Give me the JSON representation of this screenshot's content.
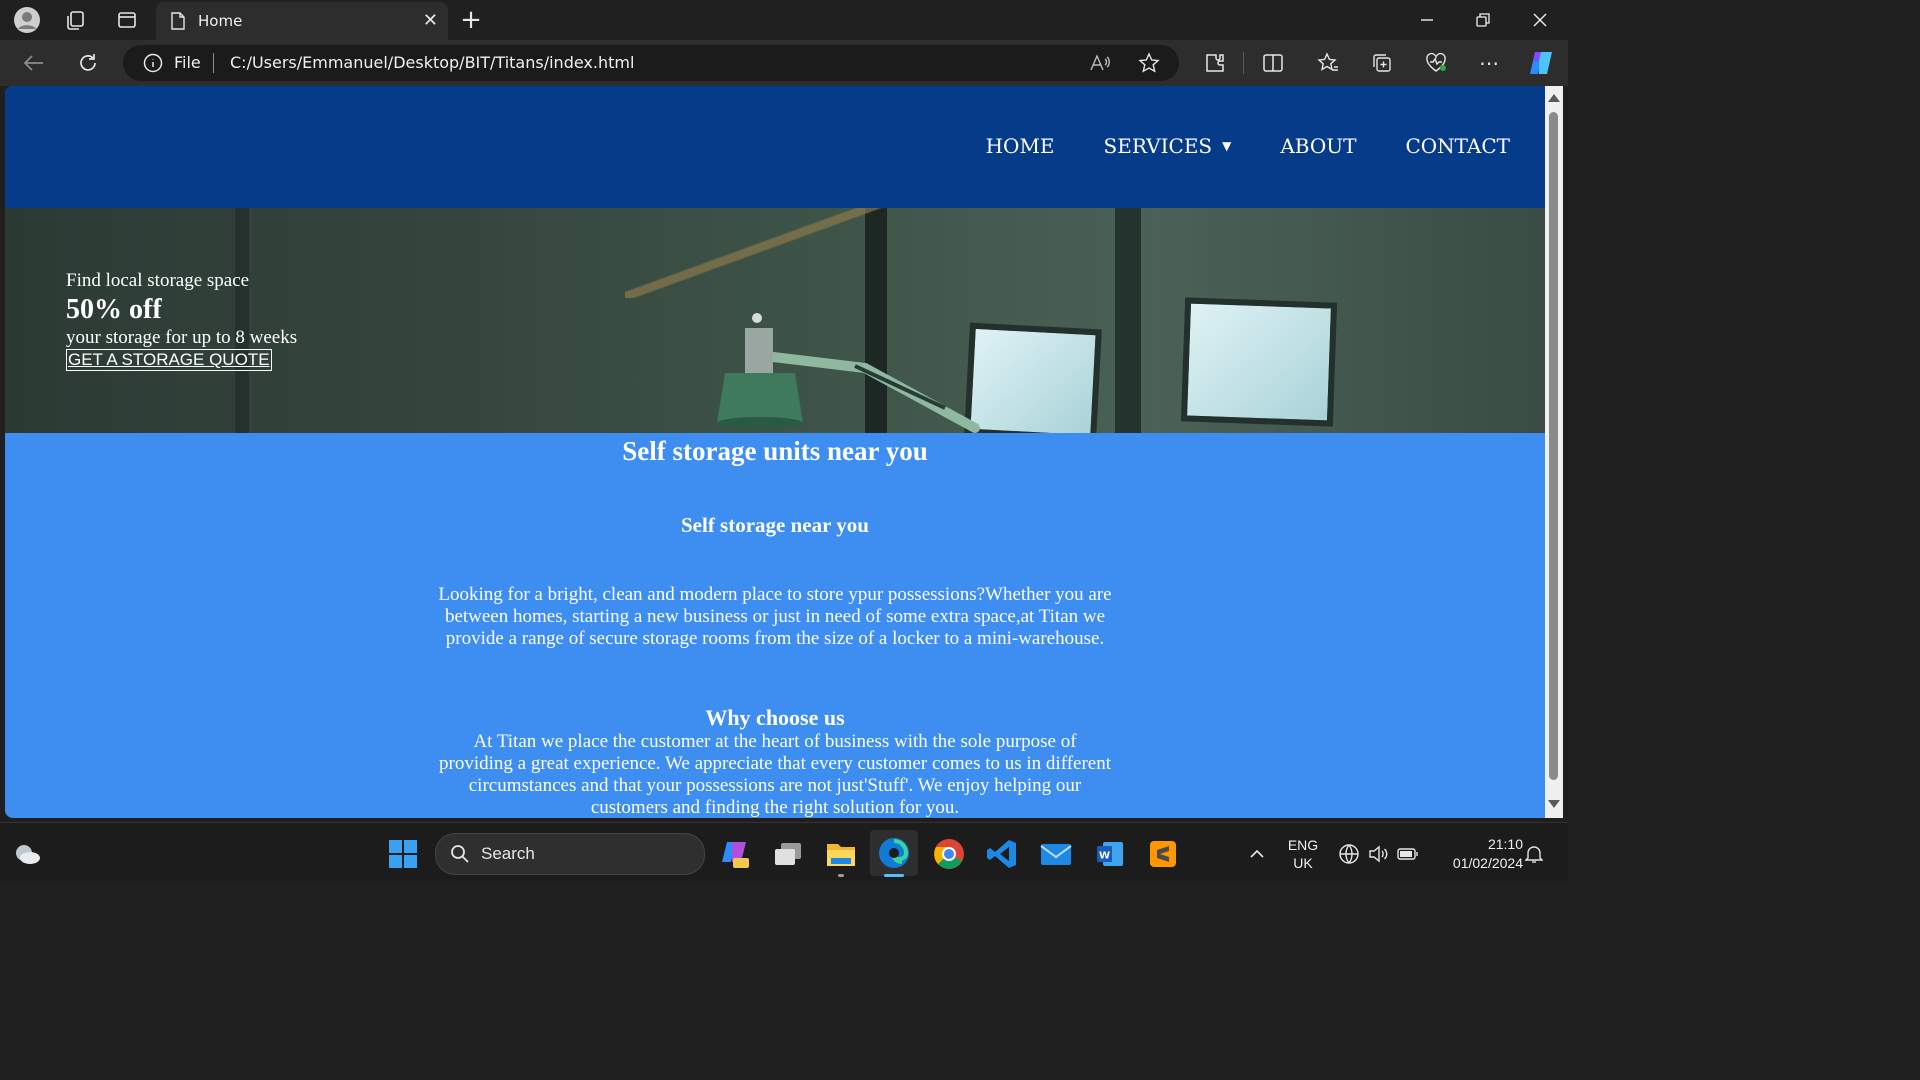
{
  "browser": {
    "tab_title": "Home",
    "address_scheme": "File",
    "address_url": "C:/Users/Emmanuel/Desktop/BIT/Titans/index.html"
  },
  "site": {
    "nav": [
      {
        "label": "HOME"
      },
      {
        "label": "SERVICES"
      },
      {
        "label": "ABOUT"
      },
      {
        "label": "CONTACT"
      }
    ],
    "hero": {
      "line1": "Find local storage space",
      "line2": "50% off",
      "line3": "your storage for up to 8 weeks",
      "cta": "GET A STORAGE QUOTE"
    },
    "main": {
      "title": "Self storage units near you",
      "subtitle": "Self storage near you",
      "intro": "Looking for a bright, clean and modern place to store ypur possessions?Whether you are between homes, starting a new business or just in need of some extra space,at Titan we provide a range of secure storage rooms from the size of a locker to a mini-warehouse.",
      "why_title": "Why choose us",
      "why_text": "At Titan we place the customer at the heart of business with the sole purpose of providing a great experience. We appreciate that every customer comes to us in different circumstances and that your possessions are not just'Stuff'. We enjoy helping our customers and finding the right solution for you."
    },
    "colors": {
      "header": "#053b88",
      "content_bg": "#3d8ef0"
    }
  },
  "taskbar": {
    "search_label": "Search",
    "lang_top": "ENG",
    "lang_bottom": "UK",
    "time": "21:10",
    "date": "01/02/2024"
  }
}
